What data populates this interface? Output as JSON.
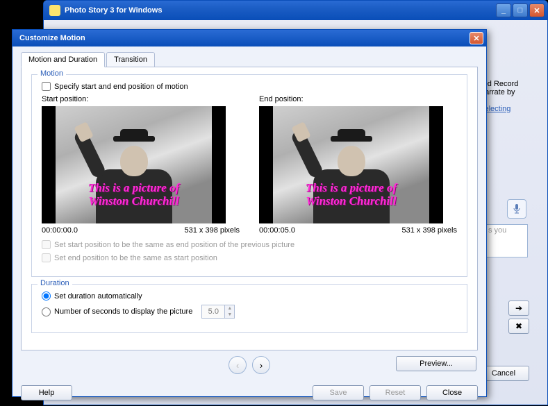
{
  "parent": {
    "title": "Photo Story 3 for Windows",
    "bg_text1": "red Record",
    "bg_text2": "narrate by",
    "bg_link": "selecting",
    "textarea_hint": "s you",
    "cancel": "Cancel"
  },
  "dialog": {
    "title": "Customize Motion",
    "tabs": {
      "motion": "Motion and Duration",
      "transition": "Transition"
    },
    "motion": {
      "legend": "Motion",
      "specify": "Specify start and end position of motion",
      "start_label": "Start position:",
      "end_label": "End position:",
      "caption_line1": "This is a picture of",
      "caption_line2": "Winston Churchill",
      "start_time": "00:00:00.0",
      "end_time": "00:00:05.0",
      "dims": "531 x 398 pixels",
      "set_start_same": "Set start position to be the same as end position of the previous picture",
      "set_end_same": "Set end position to be the same as start position"
    },
    "duration": {
      "legend": "Duration",
      "auto": "Set duration automatically",
      "seconds_label": "Number of seconds to display the picture",
      "seconds_value": "5.0"
    },
    "buttons": {
      "preview": "Preview...",
      "help": "Help",
      "save": "Save",
      "reset": "Reset",
      "close": "Close"
    }
  }
}
